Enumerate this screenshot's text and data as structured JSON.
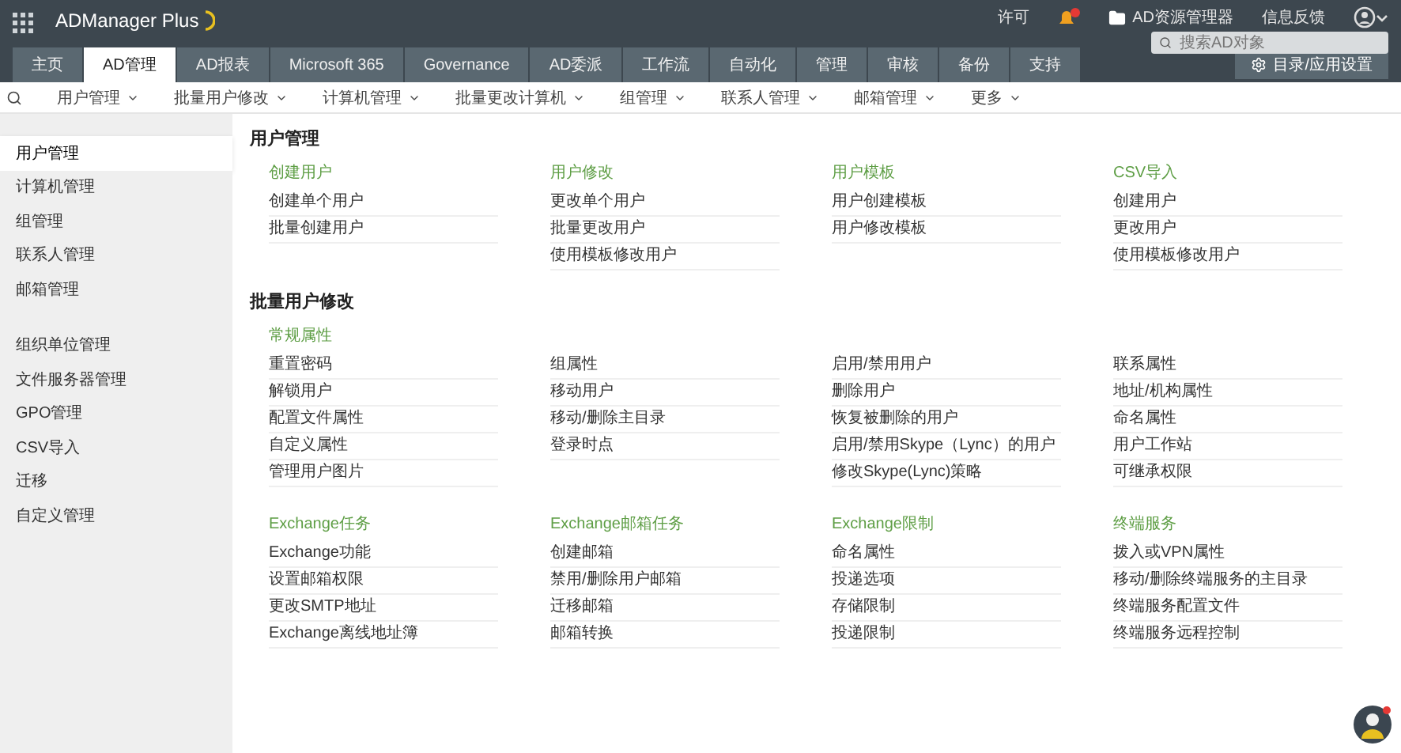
{
  "header": {
    "product": "ADManager Plus",
    "links": [
      {
        "kind": "text",
        "label": "许可"
      },
      {
        "kind": "bell"
      },
      {
        "kind": "folder",
        "label": "AD资源管理器"
      },
      {
        "kind": "text",
        "label": "信息反馈"
      },
      {
        "kind": "user"
      }
    ],
    "search": {
      "placeholder": "搜索AD对象"
    }
  },
  "tabs": [
    {
      "label": "主页",
      "selected": false
    },
    {
      "label": "AD管理",
      "selected": true
    },
    {
      "label": "AD报表",
      "selected": false
    },
    {
      "label": "Microsoft 365",
      "selected": false
    },
    {
      "label": "Governance",
      "selected": false
    },
    {
      "label": "AD委派",
      "selected": false
    },
    {
      "label": "工作流",
      "selected": false
    },
    {
      "label": "自动化",
      "selected": false
    },
    {
      "label": "管理",
      "selected": false
    },
    {
      "label": "审核",
      "selected": false
    },
    {
      "label": "备份",
      "selected": false
    },
    {
      "label": "支持",
      "selected": false
    }
  ],
  "settings_button": "目录/应用设置",
  "subnav": [
    "用户管理",
    "批量用户修改",
    "计算机管理",
    "批量更改计算机",
    "组管理",
    "联系人管理",
    "邮箱管理",
    "更多"
  ],
  "sidebar": {
    "groups": [
      [
        {
          "label": "用户管理",
          "selected": true
        },
        {
          "label": "计算机管理",
          "selected": false
        },
        {
          "label": "组管理",
          "selected": false
        },
        {
          "label": "联系人管理",
          "selected": false
        },
        {
          "label": "邮箱管理",
          "selected": false
        }
      ],
      [
        {
          "label": "组织单位管理",
          "selected": false
        },
        {
          "label": "文件服务器管理",
          "selected": false
        },
        {
          "label": "GPO管理",
          "selected": false
        },
        {
          "label": "CSV导入",
          "selected": false
        },
        {
          "label": "迁移",
          "selected": false
        },
        {
          "label": "自定义管理",
          "selected": false
        }
      ]
    ]
  },
  "sections": [
    {
      "title": "用户管理",
      "blocks": [
        {
          "columns": [
            {
              "heading": "创建用户",
              "links": [
                "创建单个用户",
                "批量创建用户"
              ]
            },
            {
              "heading": "用户修改",
              "links": [
                "更改单个用户",
                "批量更改用户",
                "使用模板修改用户"
              ]
            },
            {
              "heading": "用户模板",
              "links": [
                "用户创建模板",
                "用户修改模板"
              ]
            },
            {
              "heading": "CSV导入",
              "links": [
                "创建用户",
                "更改用户",
                "使用模板修改用户"
              ]
            }
          ]
        }
      ]
    },
    {
      "title": "批量用户修改",
      "blocks": [
        {
          "columns": [
            {
              "heading": "常规属性",
              "links": [
                "重置密码",
                "解锁用户",
                "配置文件属性",
                "自定义属性",
                "管理用户图片"
              ]
            },
            {
              "links": [
                "组属性",
                "移动用户",
                "移动/删除主目录",
                "登录时点"
              ]
            },
            {
              "links": [
                "启用/禁用用户",
                "删除用户",
                "恢复被删除的用户",
                "启用/禁用Skype（Lync）的用户",
                "修改Skype(Lync)策略"
              ]
            },
            {
              "links": [
                "联系属性",
                "地址/机构属性",
                "命名属性",
                "用户工作站",
                "可继承权限"
              ]
            }
          ]
        },
        {
          "columns": [
            {
              "heading": "Exchange任务",
              "links": [
                "Exchange功能",
                "设置邮箱权限",
                "更改SMTP地址",
                "Exchange离线地址簿"
              ]
            },
            {
              "heading": "Exchange邮箱任务",
              "links": [
                "创建邮箱",
                "禁用/删除用户邮箱",
                "迁移邮箱",
                "邮箱转换"
              ]
            },
            {
              "heading": "Exchange限制",
              "links": [
                "命名属性",
                "投递选项",
                "存储限制",
                "投递限制"
              ]
            },
            {
              "heading": "终端服务",
              "links": [
                "拨入或VPN属性",
                "移动/删除终端服务的主目录",
                "终端服务配置文件",
                "终端服务远程控制"
              ]
            }
          ]
        }
      ]
    }
  ]
}
